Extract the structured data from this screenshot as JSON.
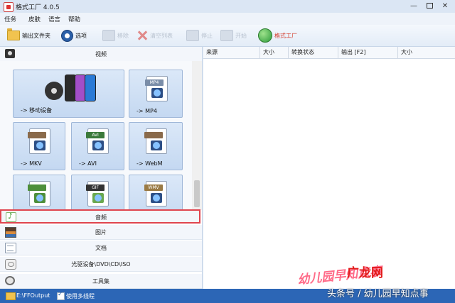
{
  "window": {
    "title": "格式工厂 4.0.5",
    "minimize": "—",
    "close": "✕"
  },
  "menu": [
    "任务",
    "皮肤",
    "语言",
    "帮助"
  ],
  "toolbar": {
    "output_folder": "输出文件夹",
    "options": "选项",
    "remove": "移除",
    "clear_list": "清空列表",
    "stop": "停止",
    "start": "开始",
    "brand": "格式工厂"
  },
  "categories": {
    "video": "视频",
    "audio": "音频",
    "image": "图片",
    "document": "文档",
    "disc": "光驱设备\\DVD\\CD\\ISO",
    "tools": "工具集"
  },
  "video_tiles": [
    {
      "label": "-> 移动设备",
      "icon": "mobile-device-icon"
    },
    {
      "label": "-> MP4",
      "icon": "mp4-icon",
      "tag": "MP4",
      "color": "#7a8da8"
    },
    {
      "label": "-> MKV",
      "icon": "mkv-icon",
      "tag": "",
      "color": "#8a6a4a"
    },
    {
      "label": "-> AVI",
      "icon": "avi-icon",
      "tag": "AVI",
      "color": "#3b7a3b"
    },
    {
      "label": "-> WebM",
      "icon": "webm-icon",
      "tag": "",
      "color": "#8a6a4a"
    },
    {
      "label": "",
      "icon": "tile-icon-6",
      "tag": "",
      "color": "#4e8f3a"
    },
    {
      "label": "",
      "icon": "gif-icon",
      "tag": "GIF",
      "color": "#333333"
    },
    {
      "label": "",
      "icon": "wmv-icon",
      "tag": "WMV",
      "color": "#9a7a44"
    }
  ],
  "list_columns": [
    "来源",
    "大小",
    "转换状态",
    "输出 [F2]",
    "大小"
  ],
  "status": {
    "path": "E:\\FFOutput",
    "multithread": "使用多线程"
  },
  "watermark": {
    "left": "幼儿园早知点事",
    "brand": "广龙网",
    "bottom": "头条号 / 幼儿园早知点事"
  },
  "colors": {
    "highlight": "#e0454f",
    "statusbar": "#2c66b6",
    "accent_text": "#d43a2a"
  }
}
